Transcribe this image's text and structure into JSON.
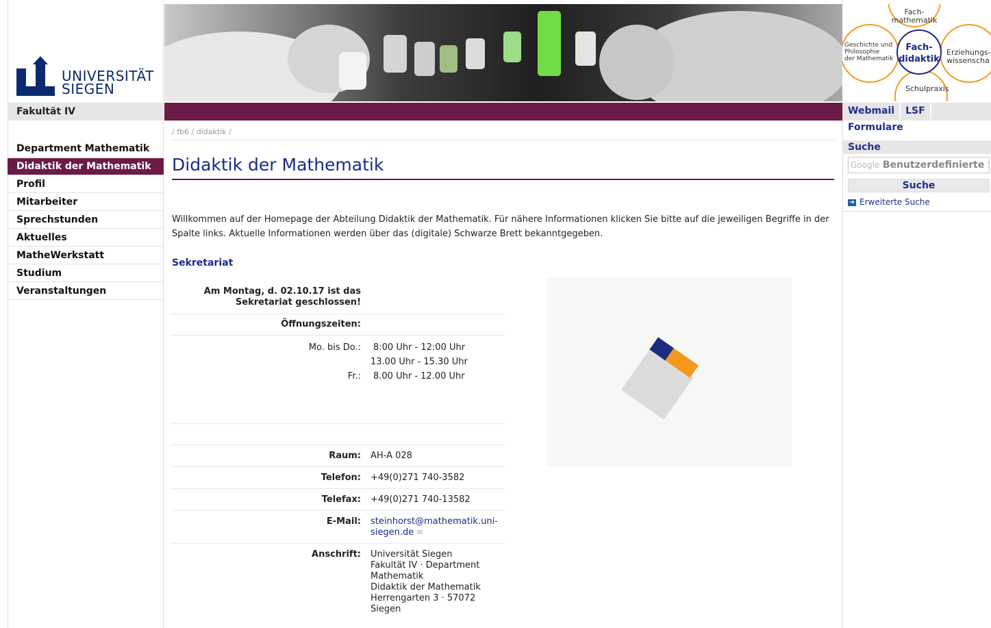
{
  "logo": {
    "line1": "UNIVERSITÄT",
    "line2": "SIEGEN"
  },
  "faculty": "Fakultät IV",
  "nav": [
    "Department Mathematik",
    "Didaktik der Mathematik",
    "Profil",
    "Mitarbeiter",
    "Sprechstunden",
    "Aktuelles",
    "MatheWerkstatt",
    "Studium",
    "Veranstaltungen"
  ],
  "toplinks": [
    "Webmail",
    "LSF",
    "Formulare"
  ],
  "diagram": {
    "top": [
      "Fach-",
      "mathematik"
    ],
    "left": [
      "Geschichte und",
      "Philosophie",
      "der Mathematik"
    ],
    "center": [
      "Fach-",
      "didaktik"
    ],
    "right": [
      "Erziehungs-",
      "wissenscha"
    ],
    "bottom": "Schulpraxis"
  },
  "search": {
    "heading": "Suche",
    "placeholder_brand": "Google",
    "placeholder": "Benutzerdefinierte Su",
    "button": "Suche",
    "advanced": "Erweiterte Suche"
  },
  "breadcrumb": [
    "/ fb6 /",
    "didaktik",
    "/"
  ],
  "page_title": "Didaktik der Mathematik",
  "welcome": "Willkommen auf der Homepage der Abteilung Didaktik der Mathematik. Für nähere Informationen klicken Sie bitte auf die jeweiligen Begriffe in der Spalte links. Aktuelle Informationen werden über das (digitale) Schwarze Brett bekanntgegeben.",
  "section_heading": "Sekretariat",
  "notice": [
    "Am Montag, d. 02.10.17 ist das",
    "Sekretariat geschlossen!"
  ],
  "hours_label": "Öffnungszeiten:",
  "hours": [
    {
      "day": "Mo. bis Do.:",
      "time": "8:00 Uhr - 12:00 Uhr"
    },
    {
      "day": "",
      "time": "13.00 Uhr - 15.30 Uhr"
    },
    {
      "day": "Fr.:",
      "time": "8.00 Uhr - 12.00 Uhr"
    }
  ],
  "contact": {
    "raum_label": "Raum:",
    "raum": "AH-A 028",
    "telefon_label": "Telefon:",
    "telefon": "+49(0)271 740-3582",
    "telefax_label": "Telefax:",
    "telefax": "+49(0)271 740-13582",
    "email_label": "E-Mail:",
    "email": [
      "steinhorst@mathematik.uni-",
      "siegen.de"
    ],
    "anschrift_label": "Anschrift:",
    "anschrift": [
      "Universität Siegen",
      "Fakultät IV · Department",
      "Mathematik",
      "Didaktik der Mathematik",
      "Herrengarten 3 · 57072",
      "Siegen"
    ]
  },
  "colors": {
    "brand_purple": "#6b1b46",
    "link_blue": "#1a2a8a",
    "logo_orange": "#f39a1e",
    "logo_navy": "#1c2a80"
  }
}
